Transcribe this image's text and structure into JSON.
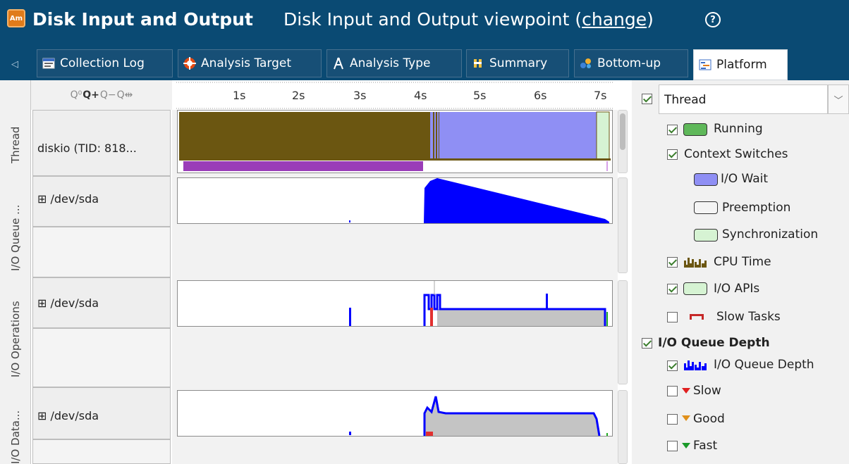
{
  "title": {
    "app_icon_text": "Am",
    "main": "Disk Input and Output",
    "viewpoint_prefix": "Disk Input and Output viewpoint (",
    "change_link": "change",
    "viewpoint_suffix": ")",
    "help_glyph": "?"
  },
  "tabs": [
    {
      "label": "Collection Log",
      "icon": "collection-log-icon"
    },
    {
      "label": "Analysis Target",
      "icon": "analysis-target-icon"
    },
    {
      "label": "Analysis Type",
      "icon": "analysis-type-icon"
    },
    {
      "label": "Summary",
      "icon": "summary-icon"
    },
    {
      "label": "Bottom-up",
      "icon": "bottom-up-icon"
    },
    {
      "label": "Platform",
      "icon": "platform-icon",
      "active": true
    }
  ],
  "zoom_tools": [
    "zoom-area-icon",
    "zoom-in-icon",
    "zoom-out-icon",
    "zoom-reset-icon"
  ],
  "ruler": {
    "ticks": [
      "1s",
      "2s",
      "3s",
      "4s",
      "5s",
      "6s",
      "7s"
    ]
  },
  "sections": {
    "thread": "Thread",
    "io_queue": "I/O Queue ...",
    "io_operations": "I/O Operations",
    "io_data": "I/O Data..."
  },
  "rows": {
    "thread_row": "diskio (TID: 818...",
    "queue_row": "⊞ /dev/sda",
    "ops_row": "⊞ /dev/sda",
    "data_row": "⊞ /dev/sda"
  },
  "colors": {
    "cpu_brown": "#6b5611",
    "io_wait_blue": "#8f8ff4",
    "sync_green": "#d6f3d3",
    "purple": "#9a3db8",
    "queue_blue": "#0000ff",
    "gray_fill": "#c4c4c4",
    "title_bar": "#0a4a73"
  },
  "timeline_data": {
    "time_range_s": [
      0,
      7.2
    ],
    "thread_cpu_time_until_s": 4.05,
    "thread_io_wait_from_s": 4.05,
    "thread_io_wait_until_s": 6.95,
    "thread_sync_from_s": 6.95,
    "io_queue_depth": [
      [
        2.85,
        0.05
      ],
      [
        4.0,
        0
      ],
      [
        4.02,
        0.9
      ],
      [
        4.2,
        0.98
      ],
      [
        7.0,
        0.02
      ]
    ],
    "io_operations": [
      [
        2.85,
        0.4
      ],
      [
        4.0,
        0.9
      ],
      [
        4.3,
        0.35
      ],
      [
        6.1,
        0.35
      ],
      [
        6.15,
        0.7
      ],
      [
        7.05,
        0.35
      ]
    ],
    "io_data_transfer": [
      [
        2.85,
        0.06
      ],
      [
        4.0,
        0.5
      ],
      [
        4.2,
        0.6
      ],
      [
        6.95,
        0.55
      ],
      [
        7.05,
        0.02
      ]
    ]
  },
  "legend": {
    "dropdown_value": "Thread",
    "dropdown_checked": true,
    "items": [
      {
        "label": "Running",
        "checked": true,
        "swatch": "#5fb85a"
      },
      {
        "label": "Context Switches",
        "checked": true
      },
      {
        "label": "I/O Wait",
        "swatch": "#8f8ff4"
      },
      {
        "label": "Preemption",
        "swatch": "#f4f4f4"
      },
      {
        "label": "Synchronization",
        "swatch": "#d6f3d3"
      },
      {
        "label": "CPU Time",
        "checked": true,
        "icon": "cpu-time-chart-icon"
      },
      {
        "label": "I/O APIs",
        "checked": true,
        "swatch": "#d6f3d3"
      },
      {
        "label": "Slow Tasks",
        "checked": false,
        "icon": "slow-tasks-icon"
      },
      {
        "label": "I/O Queue Depth",
        "checked": true,
        "bold": true
      },
      {
        "label": "I/O Queue Depth",
        "checked": true,
        "icon": "io-queue-chart-icon"
      },
      {
        "label": "Slow",
        "checked": false,
        "icon": "red-marker-icon"
      },
      {
        "label": "Good",
        "checked": false,
        "icon": "orange-marker-icon"
      },
      {
        "label": "Fast",
        "checked": false,
        "icon": "green-marker-icon"
      }
    ]
  }
}
